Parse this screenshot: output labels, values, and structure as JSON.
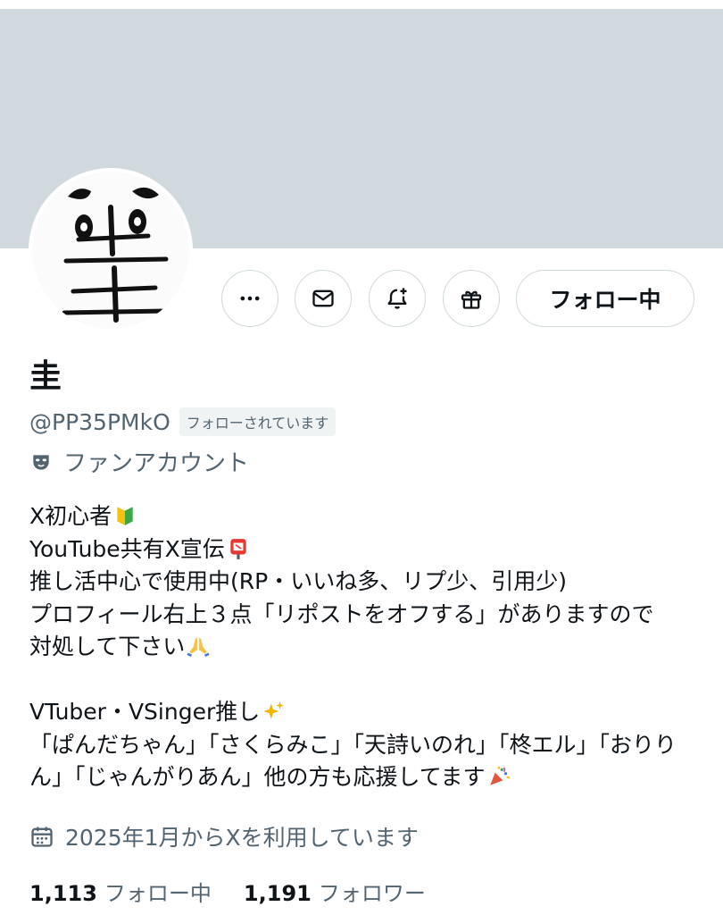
{
  "profile": {
    "name": "圭",
    "handle": "@PP35PMkO",
    "follows_you_badge": "フォローされています",
    "category": "ファンアカウント",
    "category_icon": "theater-masks-icon",
    "bio_lines": [
      "X初心者",
      "YouTube共有X宣伝",
      "推し活中心で使用中(RP・いいね多、リプ少、引用少)",
      "プロフィール右上３点「リポストをオフする」がありますので",
      "対処して下さい",
      "",
      "VTuber・VSinger推し",
      "「ぱんだちゃん」「さくらみこ」「天詩いのれ」「柊エル」「おりり",
      "ん」「じゃんがりあん」他の方も応援してます"
    ],
    "joined": "2025年1月からXを利用しています",
    "following_count": "1,113",
    "following_label": "フォロー中",
    "followers_count": "1,191",
    "followers_label": "フォロワー"
  },
  "actions": {
    "more_icon": "more-icon",
    "message_icon": "envelope-icon",
    "notify_icon": "bell-plus-icon",
    "gift_icon": "gift-icon",
    "follow_label": "フォロー中"
  },
  "colors": {
    "banner": "#cfd9de",
    "secondary_text": "#536471",
    "primary_text": "#0f1419",
    "border": "#cfd9de"
  }
}
